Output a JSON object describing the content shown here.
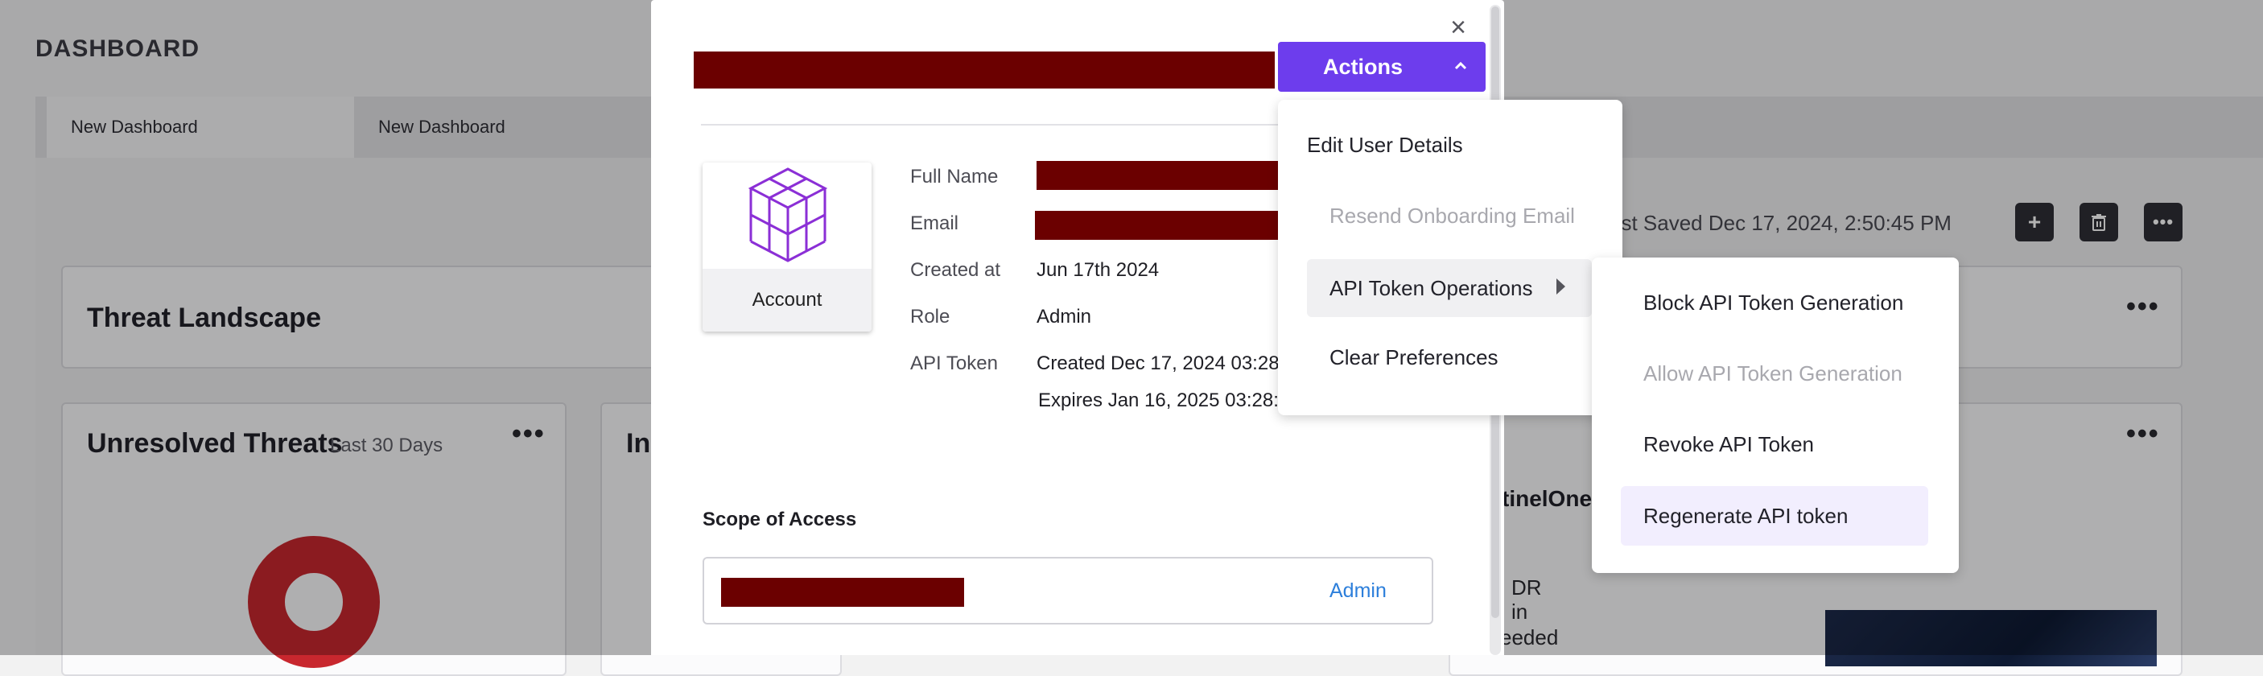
{
  "dashboard": {
    "title": "DASHBOARD",
    "tabs": [
      {
        "label": "New Dashboard"
      },
      {
        "label": "New Dashboard"
      }
    ],
    "last_saved": "ast Saved Dec 17, 2024, 2:50:45 PM",
    "tool_buttons": [
      {
        "icon": "plus-icon"
      },
      {
        "icon": "trash-icon"
      },
      {
        "icon": "more-icon"
      }
    ],
    "cards": {
      "threat_landscape": {
        "title": "Threat Landscape"
      },
      "unresolved": {
        "title": "Unresolved Threats",
        "subtitle": "Last 30 Days"
      },
      "partial_title": "In",
      "promo": {
        "title_fragment": "tinelOne",
        "lines": [
          "DR",
          "in",
          "eeded"
        ]
      }
    },
    "colors": {
      "donut": "#c8272e"
    }
  },
  "modal": {
    "close_icon": "close-icon",
    "actions_label": "Actions",
    "avatar_label": "Account",
    "fields": [
      {
        "label": "Full Name",
        "value": ""
      },
      {
        "label": "Email",
        "value": ""
      },
      {
        "label": "Created at",
        "value": "Jun 17th 2024"
      },
      {
        "label": "Role",
        "value": "Admin"
      },
      {
        "label": "API Token",
        "value": "Created Dec 17, 2024 03:28",
        "value2": "Expires Jan 16, 2025 03:28:4"
      }
    ],
    "scope_title": "Scope of Access",
    "scope_role": "Admin",
    "colors": {
      "accent": "#6d3ded",
      "redaction": "#6b0000",
      "link": "#2d7fdb"
    }
  },
  "actions_menu": {
    "items": [
      {
        "label": "Edit User Details",
        "disabled": false
      },
      {
        "label": "Resend Onboarding Email",
        "disabled": true
      },
      {
        "label": "API Token Operations",
        "disabled": false,
        "has_submenu": true
      },
      {
        "label": "Clear Preferences",
        "disabled": false
      }
    ]
  },
  "api_token_submenu": {
    "items": [
      {
        "label": "Block API Token Generation",
        "disabled": false
      },
      {
        "label": "Allow API Token Generation",
        "disabled": true
      },
      {
        "label": "Revoke API Token",
        "disabled": false
      },
      {
        "label": "Regenerate API token",
        "disabled": false
      }
    ]
  }
}
